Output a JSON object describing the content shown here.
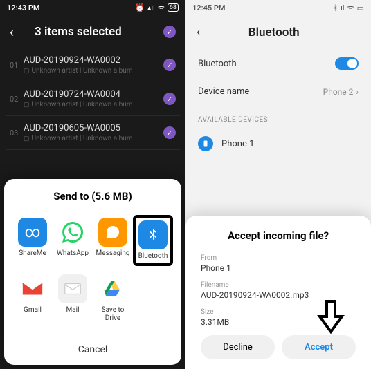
{
  "left": {
    "status": {
      "time": "12:43 PM",
      "battery": "68"
    },
    "header": {
      "title": "3 items selected"
    },
    "tracks": [
      {
        "num": "01",
        "title": "AUD-20190924-WA0002",
        "sub": "Unknown artist | Unknown album"
      },
      {
        "num": "02",
        "title": "AUD-20190724-WA0004",
        "sub": "Unknown artist | Unknown album"
      },
      {
        "num": "03",
        "title": "AUD-20190605-WA0005",
        "sub": "Unknown artist | Unknown album"
      }
    ],
    "share": {
      "title": "Send to (5.6 MB)",
      "items": {
        "shareme": "ShareMe",
        "whatsapp": "WhatsApp",
        "messaging": "Messaging",
        "bluetooth": "Bluetooth",
        "gmail": "Gmail",
        "mail": "Mail",
        "drive": "Save to Drive"
      },
      "cancel": "Cancel"
    }
  },
  "right": {
    "status": {
      "time": "12:45 PM"
    },
    "header": {
      "title": "Bluetooth"
    },
    "bluetooth_label": "Bluetooth",
    "device_name_label": "Device name",
    "device_name_value": "Phone 2",
    "available_label": "AVAILABLE DEVICES",
    "devices": [
      {
        "name": "Phone 1"
      }
    ],
    "incoming": {
      "title": "Accept incoming file?",
      "from_label": "From",
      "from_value": "Phone 1",
      "filename_label": "Filename",
      "filename_value": "AUD-20190924-WA0002.mp3",
      "size_label": "Size",
      "size_value": "3.31MB",
      "decline": "Decline",
      "accept": "Accept"
    }
  }
}
